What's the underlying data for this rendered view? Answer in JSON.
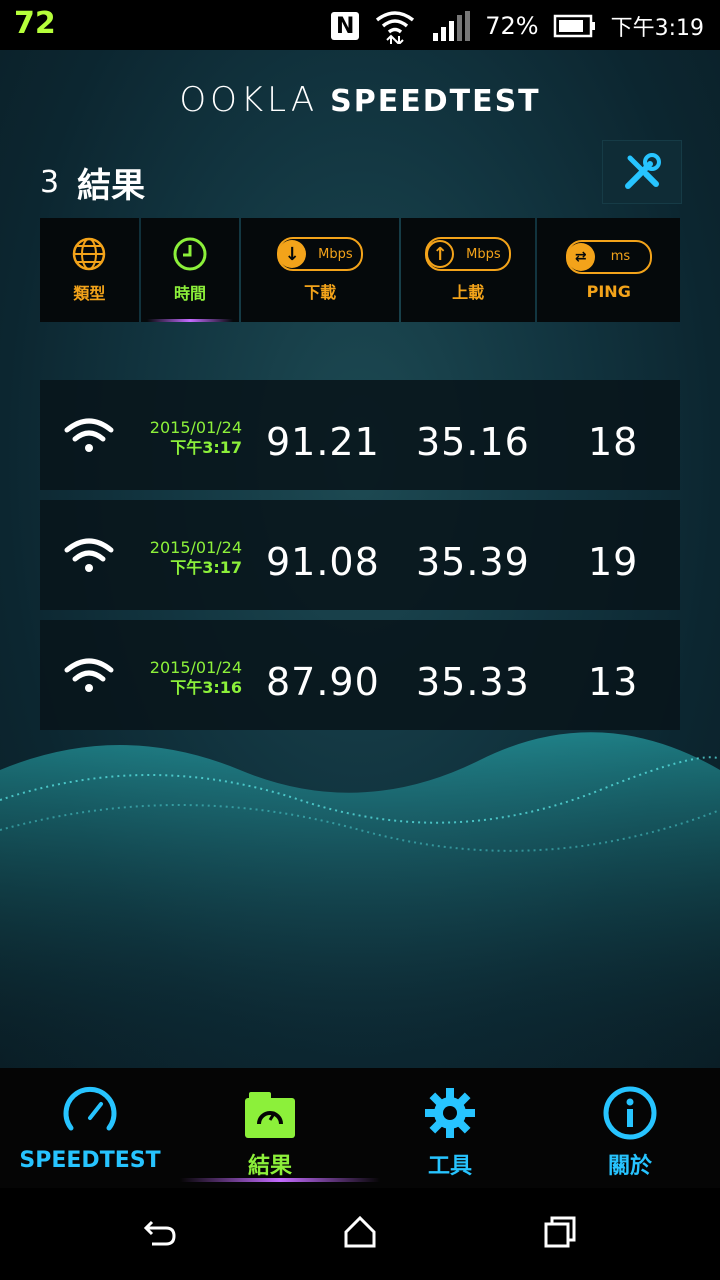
{
  "status_bar": {
    "left_number": "72",
    "nfc_label": "N",
    "battery": "72%",
    "time": "下午3:19"
  },
  "app": {
    "logo_ookla": "OOKLA",
    "logo_speedtest": "SPEEDTEST",
    "results_count": "3",
    "results_label": "結果"
  },
  "table_header": {
    "type": "類型",
    "time": "時間",
    "download": "下載",
    "download_unit": "Mbps",
    "upload": "上載",
    "upload_unit": "Mbps",
    "ping": "PING",
    "ping_unit": "ms"
  },
  "results": [
    {
      "date": "2015/01/24",
      "time": "下午3:17",
      "download": "91.21",
      "upload": "35.16",
      "ping": "18"
    },
    {
      "date": "2015/01/24",
      "time": "下午3:17",
      "download": "91.08",
      "upload": "35.39",
      "ping": "19"
    },
    {
      "date": "2015/01/24",
      "time": "下午3:16",
      "download": "87.90",
      "upload": "35.33",
      "ping": "13"
    }
  ],
  "bottom_nav": {
    "speedtest": "SPEEDTEST",
    "results": "結果",
    "tools": "工具",
    "about": "關於"
  },
  "colors": {
    "accent_orange": "#f3a31a",
    "accent_green": "#8cf03a",
    "accent_blue": "#27c4ff"
  }
}
